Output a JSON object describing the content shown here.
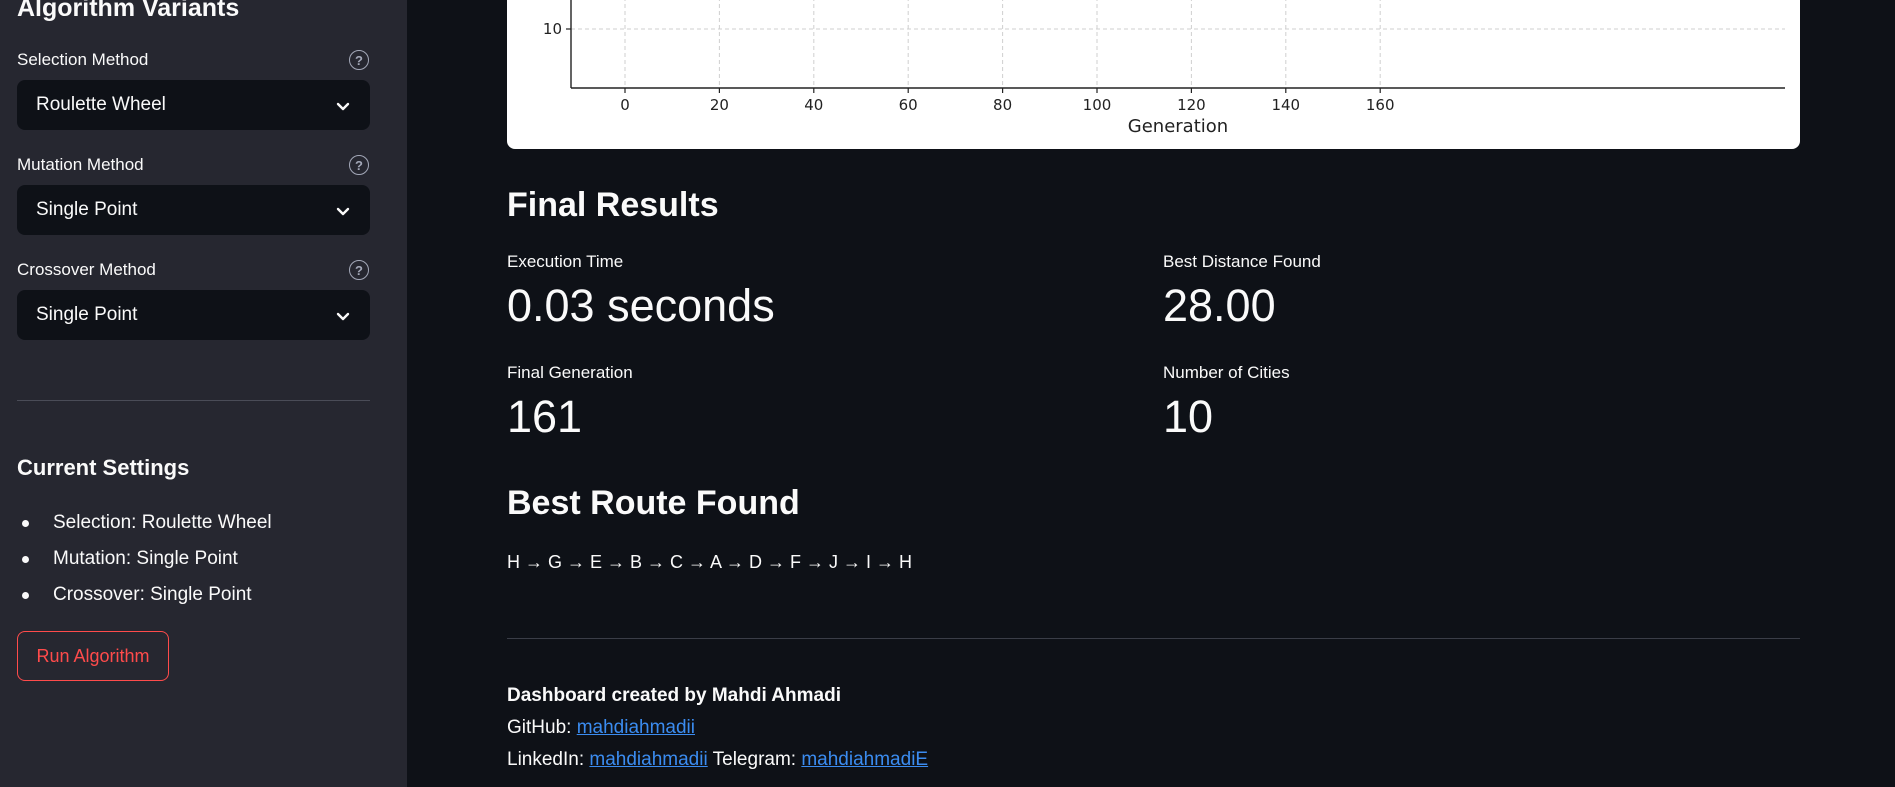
{
  "sidebar": {
    "title": "Algorithm Variants",
    "selection": {
      "label": "Selection Method",
      "value": "Roulette Wheel"
    },
    "mutation": {
      "label": "Mutation Method",
      "value": "Single Point"
    },
    "crossover": {
      "label": "Crossover Method",
      "value": "Single Point"
    },
    "current_settings_title": "Current Settings",
    "settings": [
      "Selection: Roulette Wheel",
      "Mutation: Single Point",
      "Crossover: Single Point"
    ],
    "run_button": "Run Algorithm",
    "help_glyph": "?"
  },
  "chart_data": {
    "type": "line",
    "xlabel": "Generation",
    "x_ticks": [
      "0",
      "20",
      "40",
      "60",
      "80",
      "100",
      "120",
      "140",
      "160"
    ],
    "y_ticks_visible": [
      "10"
    ],
    "grid": true
  },
  "results": {
    "title": "Final Results",
    "execution_time": {
      "label": "Execution Time",
      "value": "0.03 seconds"
    },
    "best_distance": {
      "label": "Best Distance Found",
      "value": "28.00"
    },
    "final_generation": {
      "label": "Final Generation",
      "value": "161"
    },
    "num_cities": {
      "label": "Number of Cities",
      "value": "10"
    }
  },
  "route": {
    "title": "Best Route Found",
    "path": "H → G → E → B → C → A → D → F → J → I → H"
  },
  "footer": {
    "created_by": "Dashboard created by Mahdi Ahmadi",
    "github_label": "GitHub:",
    "github_link": "mahdiahmadii",
    "linkedin_label": "LinkedIn:",
    "linkedin_link": "mahdiahmadii",
    "telegram_label": "Telegram:",
    "telegram_link": "mahdiahmadiE"
  },
  "colors": {
    "sidebar_bg": "#262730",
    "main_bg": "#0e1117",
    "accent_red": "#ff4b4b",
    "link_blue": "#3b8cf0"
  }
}
